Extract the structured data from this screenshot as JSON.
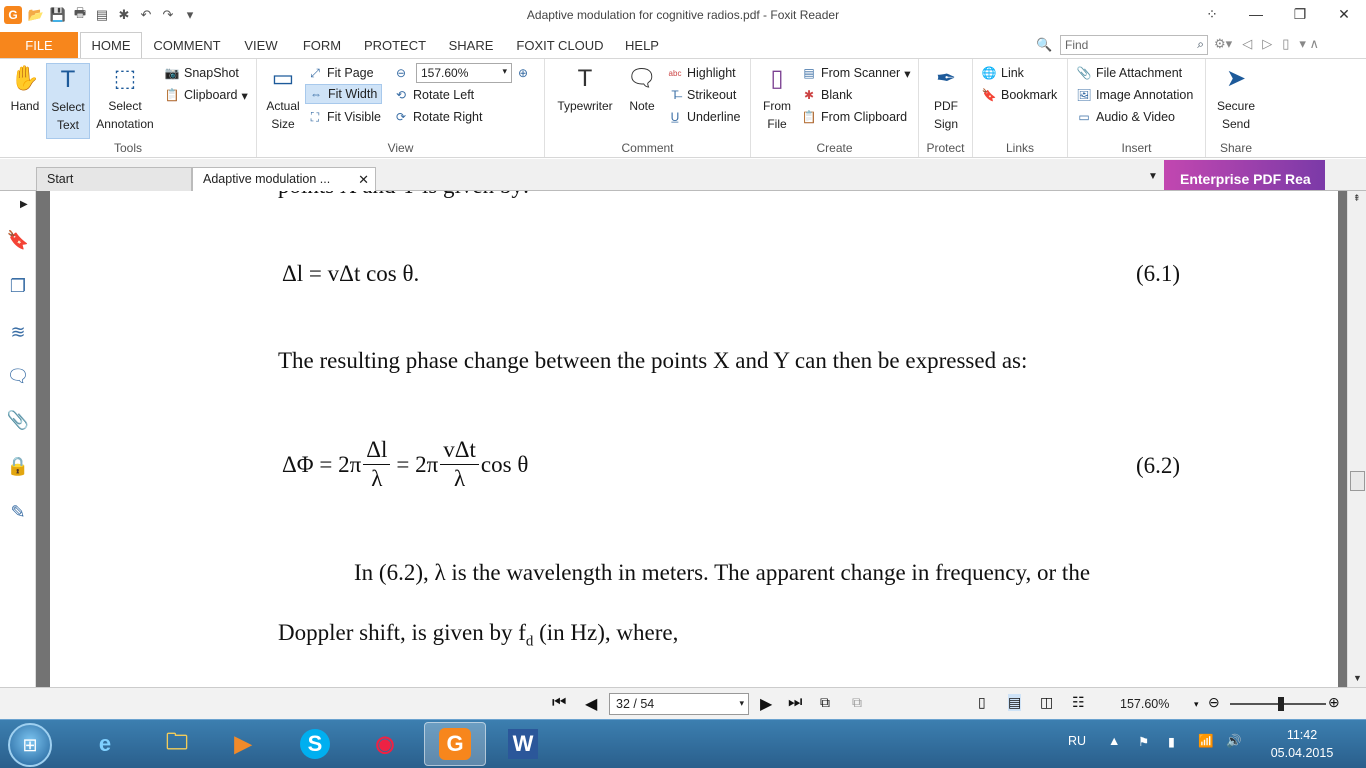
{
  "window": {
    "title": "Adaptive modulation for cognitive radios.pdf - Foxit Reader"
  },
  "menu": {
    "tabs": [
      "FILE",
      "HOME",
      "COMMENT",
      "VIEW",
      "FORM",
      "PROTECT",
      "SHARE",
      "FOXIT CLOUD",
      "HELP"
    ],
    "find_placeholder": "Find"
  },
  "ribbon": {
    "tools": {
      "hand": "Hand",
      "select_text_1": "Select",
      "select_text_2": "Text",
      "select_annot_1": "Select",
      "select_annot_2": "Annotation",
      "snapshot": "SnapShot",
      "clipboard": "Clipboard",
      "label": "Tools"
    },
    "view": {
      "actual_1": "Actual",
      "actual_2": "Size",
      "fit_page": "Fit Page",
      "fit_width": "Fit Width",
      "fit_visible": "Fit Visible",
      "zoom": "157.60%",
      "rotate_left": "Rotate Left",
      "rotate_right": "Rotate Right",
      "label": "View"
    },
    "comment": {
      "typewriter": "Typewriter",
      "note": "Note",
      "highlight": "Highlight",
      "strikeout": "Strikeout",
      "underline": "Underline",
      "label": "Comment"
    },
    "create": {
      "from_file_1": "From",
      "from_file_2": "File",
      "from_scanner": "From Scanner",
      "blank": "Blank",
      "from_clipboard": "From Clipboard",
      "label": "Create"
    },
    "protect": {
      "pdf_sign_1": "PDF",
      "pdf_sign_2": "Sign",
      "label": "Protect"
    },
    "links": {
      "link": "Link",
      "bookmark": "Bookmark",
      "label": "Links"
    },
    "insert": {
      "file_attachment": "File Attachment",
      "image_annotation": "Image Annotation",
      "audio_video": "Audio & Video",
      "label": "Insert"
    },
    "share": {
      "secure_1": "Secure",
      "secure_2": "Send",
      "label": "Share"
    }
  },
  "doc_tabs": {
    "start": "Start",
    "doc": "Adaptive modulation ...",
    "promo": "Enterprise PDF Rea"
  },
  "document": {
    "top_fragment": "points X and Y is given by:",
    "eq1": "Δl = vΔt cos θ.",
    "eq1_no": "(6.1)",
    "line2": "The resulting phase change between the points X and Y can then be expressed as:",
    "eq2_lhs": "ΔΦ = 2π",
    "eq2_f1_num": "Δl",
    "eq2_f1_den": "λ",
    "eq2_mid": "= 2π",
    "eq2_f2_num": "vΔt",
    "eq2_f2_den": "λ",
    "eq2_tail": "cos θ",
    "eq2_no": "(6.2)",
    "para1": "In (6.2),  λ  is the wavelength in meters. The apparent change in frequency, or the",
    "para2_a": "Doppler shift, is given by  f",
    "para2_sub": "d",
    "para2_b": " (in Hz), where,"
  },
  "status": {
    "page": "32 / 54",
    "zoom": "157.60%"
  },
  "taskbar": {
    "lang": "RU",
    "time": "11:42",
    "date": "05.04.2015"
  }
}
